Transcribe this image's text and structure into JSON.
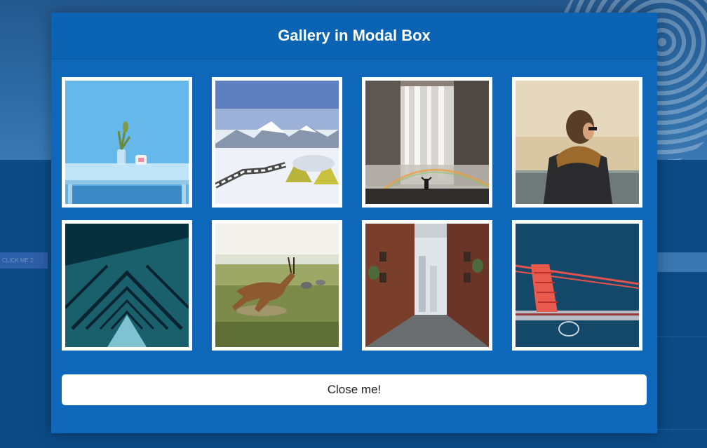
{
  "background": {
    "click_me_2_label": "CLICK ME 2"
  },
  "modal": {
    "title": "Gallery in Modal Box",
    "close_label": "Close me!",
    "images": [
      {
        "name": "table-vase-photo"
      },
      {
        "name": "snowy-mountains-tents-photo"
      },
      {
        "name": "waterfall-rainbow-person-photo"
      },
      {
        "name": "person-scarf-sea-photo"
      },
      {
        "name": "spiral-staircase-photo"
      },
      {
        "name": "antelope-savanna-photo"
      },
      {
        "name": "city-alley-photo"
      },
      {
        "name": "golden-gate-bridge-aerial-photo"
      }
    ]
  },
  "colors": {
    "modal_bg": "#0e67b8",
    "page_bg": "#0b4a86",
    "button_bg": "#ffffff"
  }
}
